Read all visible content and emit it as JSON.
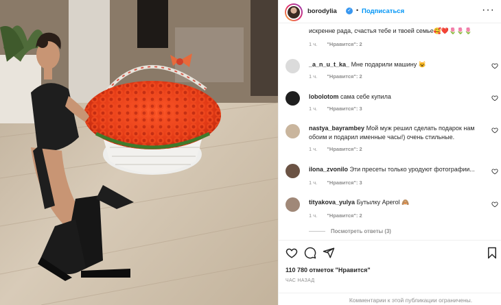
{
  "post": {
    "username": "borodylia",
    "verified_symbol": "✓",
    "separator": "•",
    "follow_label": "Подписаться",
    "more_label": "···"
  },
  "comments": [
    {
      "username": "",
      "text": "искренне рада, счастья тебе и твоей семье🥰❤️🌷🌷🌷",
      "time": "1 ч.",
      "likes": "\"Нравится\": 2",
      "avatar_color": "#ffffff",
      "show_avatar": false
    },
    {
      "username": "_a_n_u_t_ka_",
      "text": "Мне подарили машину 😺",
      "time": "1 ч.",
      "likes": "\"Нравится\": 2",
      "avatar_color": "#dbdbdb"
    },
    {
      "username": "lobolotom",
      "text": "сама себе купила",
      "time": "1 ч.",
      "likes": "\"Нравится\": 3",
      "avatar_color": "#1f1f1f"
    },
    {
      "username": "nastya_bayrambey",
      "text": "Мой муж решил сделать подарок нам обоим и подарил именные часы!) очень стильные.",
      "time": "1 ч.",
      "likes": "\"Нравится\": 2",
      "avatar_color": "#c9b59d"
    },
    {
      "username": "ilona_zvonilo",
      "text": "Эти пресеты только уродуют фотографии...",
      "time": "1 ч.",
      "likes": "\"Нравится\": 3",
      "avatar_color": "#6b5344"
    },
    {
      "username": "tityakova_yulya",
      "text": "Бутылку Aperol 🙈",
      "time": "1 ч.",
      "likes": "\"Нравится\": 2",
      "avatar_color": "#a08878"
    }
  ],
  "view_replies_label": "Посмотреть ответы (3)",
  "likes_label": "110 780 отметок \"Нравится\"",
  "time_ago": "ЧАС НАЗАД",
  "comments_limited": "Комментарии к этой публикации ограничены."
}
